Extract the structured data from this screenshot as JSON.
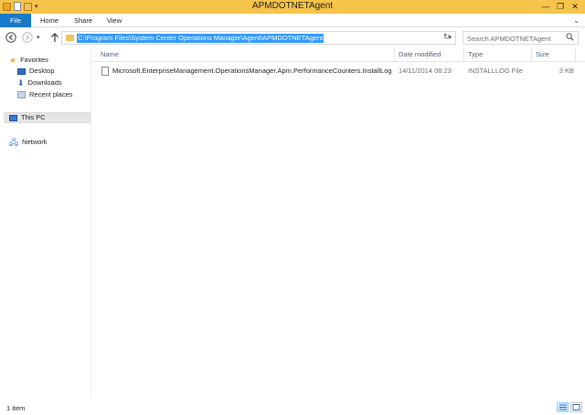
{
  "window": {
    "title": "APMDOTNETAgent",
    "controls": {
      "minimize": "—",
      "restore": "❐",
      "close": "✕"
    }
  },
  "ribbon": {
    "tabs": [
      "File",
      "Home",
      "Share",
      "View"
    ]
  },
  "address_bar": {
    "path": "C:\\Program Files\\System Center Operations Manager\\Agent\\APMDOTNETAgent"
  },
  "search": {
    "placeholder": "Search APMDOTNETAgent"
  },
  "nav_pane": {
    "favorites_label": "Favorites",
    "favorites": [
      "Desktop",
      "Downloads",
      "Recent places"
    ],
    "this_pc": "This PC",
    "network": "Network"
  },
  "columns": [
    "Name",
    "Date modified",
    "Type",
    "Size"
  ],
  "files": [
    {
      "name": "Microsoft.EnterpriseManagement.OperationsManager.Apm.PerformanceCounters.InstallLog",
      "date_modified": "14/11/2014 08:23",
      "type": "INSTALLLOG File",
      "size": "3 KB"
    }
  ],
  "status": {
    "item_count": "1 item"
  },
  "colors": {
    "title_bar": "#f6c44a",
    "file_tab": "#1979ca",
    "selection": "#3399ff"
  }
}
